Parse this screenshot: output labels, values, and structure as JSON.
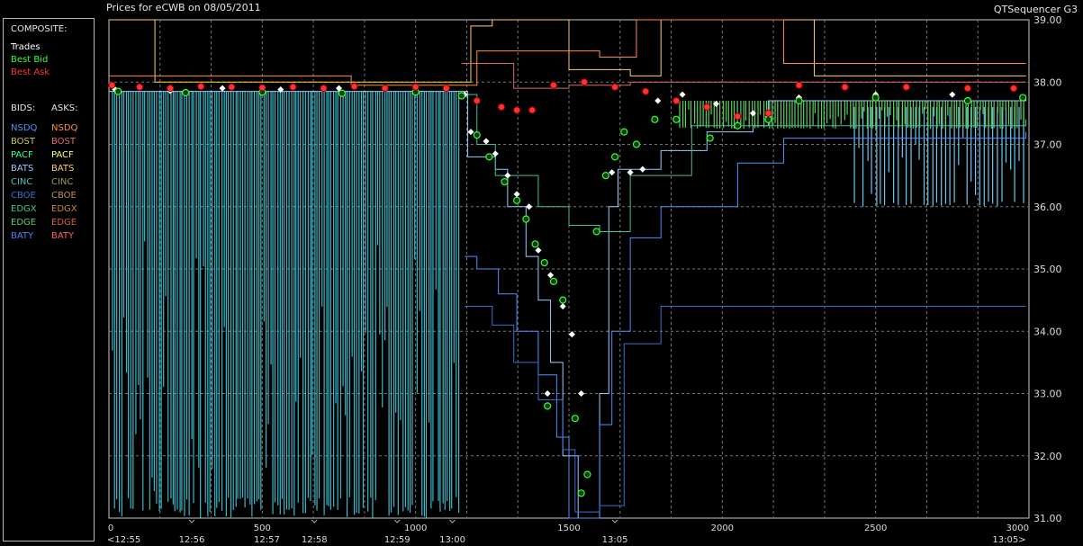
{
  "header": {
    "title": "Prices for  eCWB  on  08/05/2011",
    "app_name": "QTSequencer G3"
  },
  "legend": {
    "composite_label": "COMPOSITE:",
    "composite": [
      {
        "label": "Trades",
        "color": "#ffffff"
      },
      {
        "label": "Best Bid",
        "color": "#33ff33"
      },
      {
        "label": "Best Ask",
        "color": "#ff3333"
      }
    ],
    "bids_header": "BIDS:",
    "asks_header": "ASKS:",
    "exchanges": [
      {
        "bid": "NSDQ",
        "ask": "NSDQ",
        "bid_color": "#4f8fff",
        "ask_color": "#ff8c3a"
      },
      {
        "bid": "BOST",
        "ask": "BOST",
        "bid_color": "#c8c850",
        "ask_color": "#e06a6a"
      },
      {
        "bid": "PACF",
        "ask": "PACF",
        "bid_color": "#33ff99",
        "ask_color": "#ffff66"
      },
      {
        "bid": "BATS",
        "ask": "BATS",
        "bid_color": "#99ccff",
        "ask_color": "#ffcc66"
      },
      {
        "bid": "CINC",
        "ask": "CINC",
        "bid_color": "#4fbfbf",
        "ask_color": "#9a9a4a"
      },
      {
        "bid": "CBOE",
        "ask": "CBOE",
        "bid_color": "#3a6fcf",
        "ask_color": "#c09050"
      },
      {
        "bid": "EDGX",
        "ask": "EDGX",
        "bid_color": "#3fbfa0",
        "ask_color": "#cf7f3f"
      },
      {
        "bid": "EDGE",
        "ask": "EDGE",
        "bid_color": "#4fcf6f",
        "ask_color": "#e05a40"
      },
      {
        "bid": "BATY",
        "ask": "BATY",
        "bid_color": "#4f7fff",
        "ask_color": "#ff5f5f"
      }
    ]
  },
  "chart_data": {
    "type": "line",
    "x_axis": {
      "range": [
        0,
        3000
      ],
      "ticks": [
        0,
        500,
        1000,
        1500,
        2000,
        2500,
        3000
      ],
      "tick_labels": [
        "0",
        "500",
        "1000",
        "1500",
        "2000",
        "2500",
        "3000"
      ],
      "time_labels": [
        {
          "x": 0,
          "label": "<12:55"
        },
        {
          "x": 270,
          "label": "12:56"
        },
        {
          "x": 515,
          "label": "12:57"
        },
        {
          "x": 670,
          "label": "12:58"
        },
        {
          "x": 940,
          "label": "12:59"
        },
        {
          "x": 1120,
          "label": "13:00"
        },
        {
          "x": 1650,
          "label": "13:05"
        },
        {
          "x": 2990,
          "label": "13:05>"
        }
      ],
      "marker_ticks": [
        270,
        670,
        940,
        1120,
        1650
      ]
    },
    "y_axis": {
      "range": [
        31,
        39
      ],
      "ticks": [
        31,
        32,
        33,
        34,
        35,
        36,
        37,
        38,
        39
      ],
      "tick_labels": [
        "31.00",
        "32.00",
        "33.00",
        "34.00",
        "35.00",
        "36.00",
        "37.00",
        "38.00",
        "39.00"
      ]
    },
    "grid": true,
    "series": [
      {
        "name": "Trades",
        "kind": "points",
        "color": "#ffffff",
        "points": [
          [
            20,
            37.88
          ],
          [
            200,
            37.86
          ],
          [
            370,
            37.9
          ],
          [
            560,
            37.88
          ],
          [
            750,
            37.9
          ],
          [
            1000,
            37.86
          ],
          [
            1160,
            37.8
          ],
          [
            1180,
            37.2
          ],
          [
            1230,
            37.05
          ],
          [
            1260,
            36.85
          ],
          [
            1300,
            36.5
          ],
          [
            1330,
            36.2
          ],
          [
            1370,
            36.0
          ],
          [
            1400,
            35.3
          ],
          [
            1440,
            34.9
          ],
          [
            1480,
            34.4
          ],
          [
            1510,
            33.95
          ],
          [
            1430,
            33.0
          ],
          [
            1540,
            33.0
          ],
          [
            1590,
            35.6
          ],
          [
            1640,
            36.55
          ],
          [
            1700,
            36.55
          ],
          [
            1740,
            36.6
          ],
          [
            1790,
            37.7
          ],
          [
            1870,
            37.8
          ],
          [
            1980,
            37.65
          ],
          [
            2100,
            37.5
          ],
          [
            2150,
            37.45
          ],
          [
            2250,
            37.75
          ],
          [
            2500,
            37.8
          ],
          [
            2750,
            37.8
          ]
        ]
      },
      {
        "name": "Best Bid",
        "kind": "points",
        "color": "#33ff33",
        "points": [
          [
            30,
            37.85
          ],
          [
            250,
            37.83
          ],
          [
            500,
            37.84
          ],
          [
            760,
            37.82
          ],
          [
            1000,
            37.84
          ],
          [
            1150,
            37.78
          ],
          [
            1200,
            37.15
          ],
          [
            1240,
            36.8
          ],
          [
            1290,
            36.4
          ],
          [
            1330,
            36.1
          ],
          [
            1360,
            35.8
          ],
          [
            1390,
            35.4
          ],
          [
            1420,
            35.1
          ],
          [
            1450,
            34.8
          ],
          [
            1480,
            34.5
          ],
          [
            1430,
            32.8
          ],
          [
            1520,
            32.6
          ],
          [
            1560,
            31.7
          ],
          [
            1540,
            31.4
          ],
          [
            1590,
            35.6
          ],
          [
            1620,
            36.5
          ],
          [
            1650,
            36.8
          ],
          [
            1680,
            37.2
          ],
          [
            1720,
            37.0
          ],
          [
            1780,
            37.4
          ],
          [
            1850,
            37.4
          ],
          [
            1960,
            37.1
          ],
          [
            2050,
            37.3
          ],
          [
            2150,
            37.4
          ],
          [
            2250,
            37.7
          ],
          [
            2500,
            37.75
          ],
          [
            2800,
            37.7
          ],
          [
            2980,
            37.75
          ]
        ]
      },
      {
        "name": "Best Ask",
        "kind": "points",
        "color": "#ff3333",
        "points": [
          [
            10,
            37.95
          ],
          [
            100,
            37.92
          ],
          [
            200,
            37.9
          ],
          [
            300,
            37.93
          ],
          [
            400,
            37.92
          ],
          [
            500,
            37.91
          ],
          [
            600,
            37.92
          ],
          [
            700,
            37.9
          ],
          [
            800,
            37.93
          ],
          [
            900,
            37.9
          ],
          [
            1000,
            37.92
          ],
          [
            1100,
            37.9
          ],
          [
            1200,
            37.7
          ],
          [
            1280,
            37.6
          ],
          [
            1330,
            37.55
          ],
          [
            1380,
            37.55
          ],
          [
            1450,
            37.95
          ],
          [
            1550,
            38.0
          ],
          [
            1650,
            37.92
          ],
          [
            1750,
            37.85
          ],
          [
            1850,
            37.7
          ],
          [
            1950,
            37.6
          ],
          [
            2050,
            37.45
          ],
          [
            2150,
            37.5
          ],
          [
            2250,
            37.95
          ],
          [
            2400,
            37.92
          ],
          [
            2600,
            37.92
          ],
          [
            2800,
            37.9
          ],
          [
            2950,
            37.9
          ]
        ]
      },
      {
        "name": "BATS",
        "kind": "step",
        "color": "#99ccff",
        "points": [
          [
            0,
            37.85
          ],
          [
            1140,
            37.85
          ],
          [
            1170,
            36.8
          ],
          [
            1260,
            36.6
          ],
          [
            1300,
            36.0
          ],
          [
            1360,
            35.2
          ],
          [
            1400,
            34.5
          ],
          [
            1440,
            33.5
          ],
          [
            1480,
            32.0
          ],
          [
            1530,
            31.0
          ],
          [
            1570,
            31.0
          ],
          [
            1600,
            33.0
          ],
          [
            1630,
            36.0
          ],
          [
            1660,
            36.6
          ],
          [
            1800,
            36.9
          ],
          [
            1950,
            37.2
          ],
          [
            2100,
            37.3
          ],
          [
            2150,
            37.7
          ],
          [
            2990,
            37.75
          ]
        ]
      },
      {
        "name": "BATS-ask",
        "kind": "step",
        "color": "#ffcc66",
        "points": [
          [
            0,
            39.0
          ],
          [
            140,
            39.0
          ],
          [
            150,
            38.0
          ],
          [
            1150,
            38.0
          ],
          [
            1180,
            38.9
          ],
          [
            1250,
            39.0
          ],
          [
            1500,
            38.2
          ],
          [
            1700,
            38.1
          ],
          [
            1800,
            39.0
          ],
          [
            2200,
            39.0
          ],
          [
            2300,
            38.1
          ],
          [
            2990,
            38.1
          ]
        ]
      },
      {
        "name": "NSDQ",
        "kind": "step",
        "color": "#4f8fff",
        "points": [
          [
            1160,
            35.2
          ],
          [
            1200,
            35.0
          ],
          [
            1270,
            34.6
          ],
          [
            1330,
            34.0
          ],
          [
            1400,
            33.3
          ],
          [
            1460,
            32.3
          ],
          [
            1500,
            31.0
          ],
          [
            1560,
            31.0
          ],
          [
            1600,
            32.5
          ],
          [
            1640,
            34.0
          ],
          [
            1700,
            35.5
          ],
          [
            1800,
            36.0
          ],
          [
            2050,
            36.7
          ],
          [
            2200,
            37.1
          ],
          [
            2990,
            37.2
          ]
        ]
      },
      {
        "name": "CBOE",
        "kind": "step",
        "color": "#3a6fcf",
        "points": [
          [
            1160,
            34.4
          ],
          [
            1250,
            34.1
          ],
          [
            1320,
            33.5
          ],
          [
            1400,
            32.9
          ],
          [
            1480,
            32.1
          ],
          [
            1520,
            31.1
          ],
          [
            1600,
            31.2
          ],
          [
            1680,
            33.8
          ],
          [
            1800,
            34.4
          ],
          [
            2990,
            34.4
          ]
        ]
      },
      {
        "name": "EDGX",
        "kind": "step",
        "color": "#3fbfa0",
        "points": [
          [
            1150,
            37.8
          ],
          [
            1200,
            37.0
          ],
          [
            1260,
            36.5
          ],
          [
            1400,
            36.0
          ],
          [
            1500,
            35.7
          ],
          [
            1600,
            35.6
          ],
          [
            1700,
            36.5
          ],
          [
            1900,
            37.3
          ],
          [
            2990,
            37.4
          ]
        ]
      },
      {
        "name": "BOST-ask",
        "kind": "step",
        "color": "#e06a6a",
        "points": [
          [
            1150,
            38.3
          ],
          [
            1300,
            38.3
          ],
          [
            1320,
            37.9
          ],
          [
            1500,
            37.95
          ],
          [
            1700,
            38.0
          ],
          [
            2990,
            38.0
          ]
        ]
      },
      {
        "name": "NSDQ-ask",
        "kind": "step",
        "color": "#ff8c3a",
        "points": [
          [
            0,
            38.1
          ],
          [
            780,
            38.1
          ],
          [
            790,
            37.95
          ],
          [
            1150,
            37.95
          ],
          [
            1200,
            38.5
          ],
          [
            1600,
            38.4
          ],
          [
            1720,
            39.0
          ],
          [
            2100,
            39.0
          ],
          [
            2200,
            38.3
          ],
          [
            2990,
            38.3
          ]
        ]
      }
    ],
    "bid_spikes": {
      "color": "#3ab8c8",
      "x_from": 10,
      "x_to": 1140,
      "count": 150,
      "top": 37.85,
      "bottom": 31.0
    },
    "late_spikes": {
      "color": "#6fc7f0",
      "x_from": 2430,
      "x_to": 2980,
      "count": 40,
      "top": 37.6,
      "bottom": 36.0
    },
    "green_bars": {
      "color": "#5fcf5f",
      "x_from": 1860,
      "x_to": 2980,
      "count": 120,
      "top": 37.7,
      "bottom": 37.25
    }
  }
}
